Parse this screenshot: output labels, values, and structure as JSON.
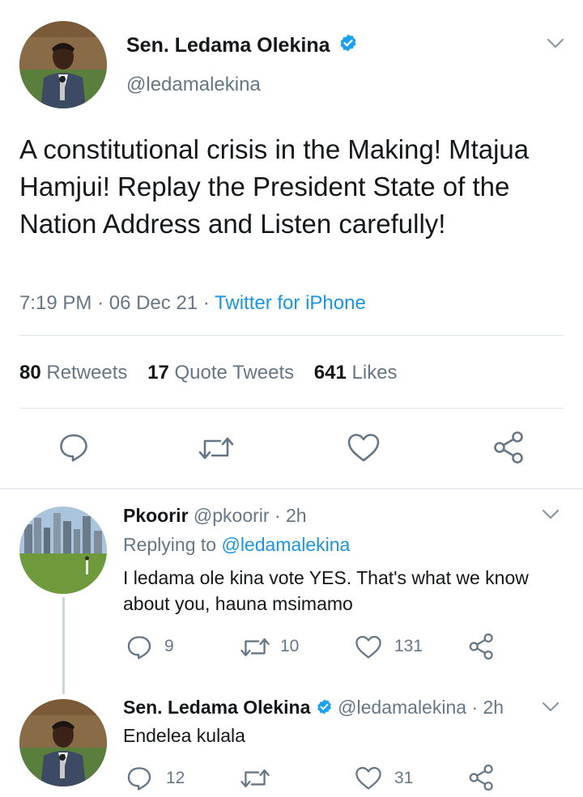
{
  "main_tweet": {
    "author_name": "Sen. Ledama Olekina",
    "handle": "@ledamalekina",
    "text": "A constitutional crisis in the Making! Mtajua Hamjui! Replay the President State of the Nation Address and Listen carefully!",
    "time": "7:19 PM",
    "date_sep": "·",
    "date": "06 Dec 21",
    "source_sep": "·",
    "source": "Twitter for iPhone",
    "stats": {
      "retweets_count": "80",
      "retweets_label": "Retweets",
      "quotes_count": "17",
      "quotes_label": "Quote Tweets",
      "likes_count": "641",
      "likes_label": "Likes"
    },
    "action_icons": [
      "reply-icon",
      "retweet-icon",
      "like-icon",
      "share-icon"
    ]
  },
  "replies": [
    {
      "author_name": "Pkoorir",
      "handle": "@pkoorir",
      "time": "· 2h",
      "replying_prefix": "Replying to",
      "replying_to": "@ledamalekina",
      "text": "I ledama ole kina vote YES. That's what we know about you, hauna msimamo",
      "reply_count": "9",
      "retweet_count": "10",
      "like_count": "131"
    },
    {
      "author_name": "Sen. Ledama Olekina",
      "handle": "@ledamalekina",
      "time": "· 2h",
      "text": "Endelea kulala",
      "reply_count": "12",
      "retweet_count": "",
      "like_count": "31"
    }
  ],
  "colors": {
    "link": "#1b95e0",
    "muted": "#657786",
    "icon": "#657786",
    "text": "#14171a",
    "divider": "#e1e8ed"
  }
}
